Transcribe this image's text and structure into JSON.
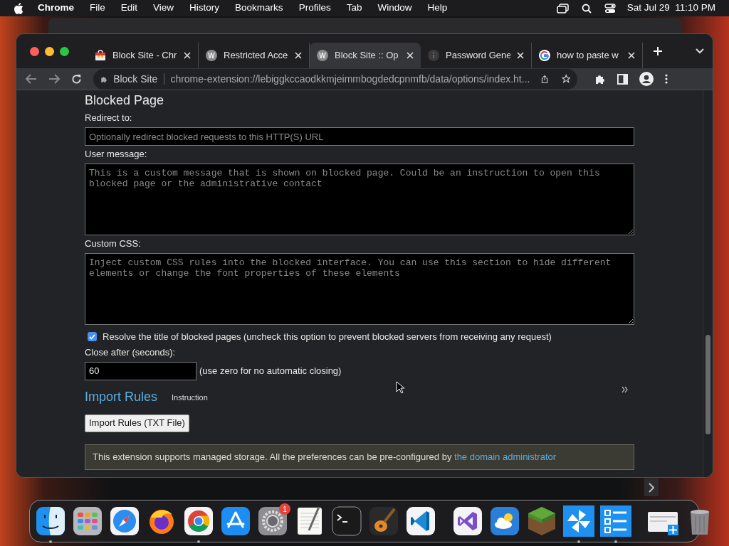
{
  "menu_bar": {
    "app": "Chrome",
    "items": [
      "File",
      "Edit",
      "View",
      "History",
      "Bookmarks",
      "Profiles",
      "Tab",
      "Window",
      "Help"
    ],
    "clock": "Sat Jul 29  11:10 PM"
  },
  "tabs": [
    {
      "kind": "store",
      "title": "Block Site - Chr",
      "selected": false
    },
    {
      "kind": "letter",
      "icon_text": "W",
      "title": "Restricted Acce",
      "selected": false
    },
    {
      "kind": "letter",
      "icon_text": "W",
      "title": "Block Site :: Op",
      "selected": true
    },
    {
      "kind": "info",
      "title": "Password Gene",
      "selected": false
    },
    {
      "kind": "google",
      "title": "how to paste w",
      "selected": false
    }
  ],
  "address_bar": {
    "site": "Block Site",
    "url": "chrome-extension://lebiggkccaodkkmjeimmbogdedcpnmfb/data/options/index.ht..."
  },
  "page": {
    "heading": "Blocked Page",
    "redirect": {
      "label": "Redirect to:",
      "placeholder": "Optionally redirect blocked requests to this HTTP(S) URL"
    },
    "user_message": {
      "label": "User message:",
      "placeholder": "This is a custom message that is shown on blocked page. Could be an instruction to open this blocked page or the administrative contact"
    },
    "custom_css": {
      "label": "Custom CSS:",
      "placeholder": "Inject custom CSS rules into the blocked interface. You can use this section to hide different elements or change the font properties of these elements"
    },
    "resolve_title": {
      "label": "Resolve the title of blocked pages (uncheck this option to prevent blocked servers from receiving any request)",
      "checked": true
    },
    "close_after": {
      "label": "Close after (seconds):",
      "value": "60",
      "hint": "(use zero for no automatic closing)"
    },
    "import_heading": "Import Rules",
    "instruction": "Instruction",
    "import_button": "Import Rules (TXT File)",
    "notice": {
      "text": "This extension supports managed storage. All the preferences can be pre-configured by ",
      "link": "the domain administrator"
    }
  },
  "dock": [
    {
      "kind": "finder",
      "running": true
    },
    {
      "kind": "launchpad",
      "running": false
    },
    {
      "kind": "safari",
      "running": false
    },
    {
      "kind": "firefox",
      "running": false
    },
    {
      "kind": "chrome",
      "running": true
    },
    {
      "kind": "appstore",
      "running": false
    },
    {
      "kind": "settings",
      "running": false,
      "badge": "1"
    },
    {
      "kind": "textedit",
      "running": false
    },
    {
      "kind": "terminal",
      "running": false
    },
    {
      "kind": "garageband",
      "running": false
    },
    {
      "kind": "vscode",
      "running": false
    },
    {
      "kind": "divider"
    },
    {
      "kind": "visualstudio",
      "running": false
    },
    {
      "kind": "weather",
      "running": false
    },
    {
      "kind": "minecraft",
      "running": false
    },
    {
      "kind": "pinwheel",
      "running": true
    },
    {
      "kind": "checklist",
      "running": true
    },
    {
      "kind": "divider"
    },
    {
      "kind": "preview",
      "running": false
    },
    {
      "kind": "trash",
      "running": false
    }
  ]
}
